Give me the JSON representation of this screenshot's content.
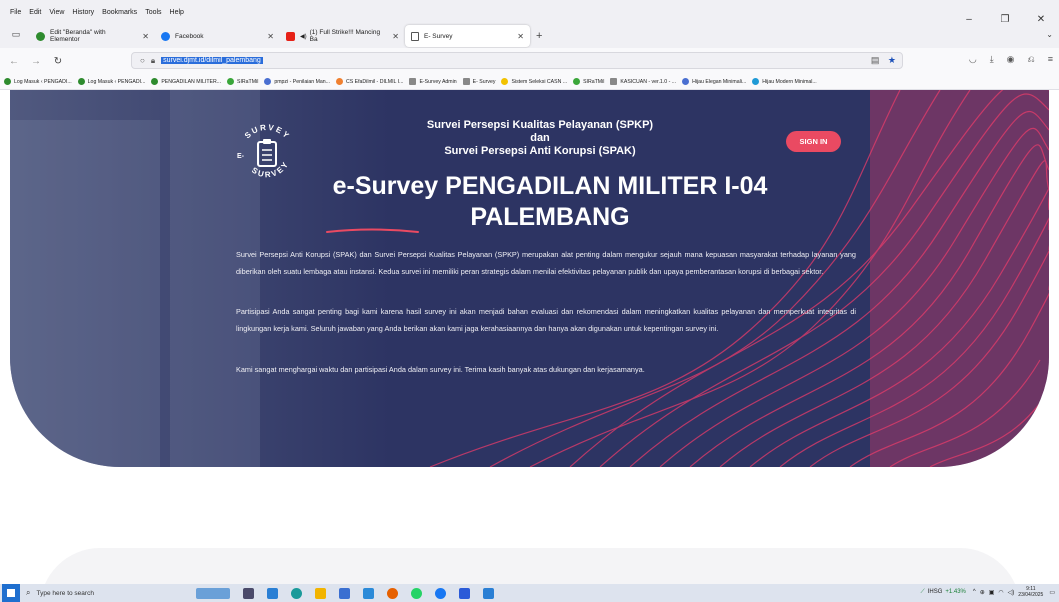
{
  "browser": {
    "menu": [
      "File",
      "Edit",
      "View",
      "History",
      "Bookmarks",
      "Tools",
      "Help"
    ],
    "tabs": [
      {
        "label": "Edit \"Beranda\" with Elementor",
        "color": "#2e8b2e"
      },
      {
        "label": "Facebook",
        "color": "#1877f2"
      },
      {
        "label": "(1) Full Strike!!! Mancing Ba",
        "color": "#e62117"
      },
      {
        "label": "E- Survey",
        "color": "#ffffff",
        "active": true
      }
    ],
    "url": "survei.djmt.id/dilmil_palembang",
    "bookmarks": [
      {
        "label": "Log Masuk ‹ PENGADI...",
        "color": "#2e8b2e"
      },
      {
        "label": "Log Masuk ‹ PENGADI...",
        "color": "#2e8b2e"
      },
      {
        "label": "PENGADILAN MILITER...",
        "color": "#2e8b2e"
      },
      {
        "label": "SIRaTMil",
        "color": "#3aa63a"
      },
      {
        "label": "pmpzi - Penilaian Man...",
        "color": "#4a6fd1"
      },
      {
        "label": "CS EfaDilmil - DILMIL I...",
        "color": "#f08030"
      },
      {
        "label": "E-Survey Admin",
        "color": "#888888"
      },
      {
        "label": "E- Survey",
        "color": "#888888"
      },
      {
        "label": "Sistem Seleksi CASN ...",
        "color": "#f2c200"
      },
      {
        "label": "SIRaTMil",
        "color": "#3aa63a"
      },
      {
        "label": "KASICUAN - ver.1.0 - ...",
        "color": "#888888"
      },
      {
        "label": "Hijau Elegan Minimali...",
        "color": "#4a6fd1"
      },
      {
        "label": "Hijau Modern Minimal...",
        "color": "#1f9ad6"
      }
    ]
  },
  "site": {
    "logo_top": "SURVEY",
    "logo_left": "E-",
    "logo_bottom": "SURVEY",
    "header_line1": "Survei Persepsi Kualitas Pelayanan (SPKP)",
    "header_line2": "dan",
    "header_line3": "Survei Persepsi Anti Korupsi (SPAK)",
    "signin": "SIGN IN",
    "title_line1": "e-Survey PENGADILAN MILITER I-04",
    "title_line2": "PALEMBANG",
    "paragraphs": [
      "Survei Persepsi Anti Korupsi (SPAK) dan Survei Persepsi Kualitas Pelayanan (SPKP) merupakan alat penting dalam mengukur sejauh mana kepuasan masyarakat terhadap layanan yang diberikan oleh suatu lembaga atau instansi. Kedua survei ini memiliki peran strategis dalam menilai efektivitas pelayanan publik dan upaya pemberantasan korupsi di berbagai sektor.",
      "Partisipasi Anda sangat penting bagi kami karena hasil survey ini akan menjadi bahan evaluasi dan rekomendasi dalam meningkatkan kualitas pelayanan dan memperkuat integritas di lingkungan kerja kami. Seluruh jawaban yang Anda berikan akan kami jaga kerahasiaannya dan hanya akan digunakan untuk kepentingan survey ini.",
      "Kami sangat menghargai waktu dan partisipasi Anda dalam survey ini. Terima kasih banyak atas dukungan dan kerjasamanya."
    ],
    "accent_color": "#ea4a62",
    "hero_color": "#2d3463"
  },
  "taskbar": {
    "search_placeholder": "Type here to search",
    "stock_name": "IHSG",
    "stock_change": "+1.43%",
    "time": "9:11",
    "date": "23/04/2025"
  }
}
